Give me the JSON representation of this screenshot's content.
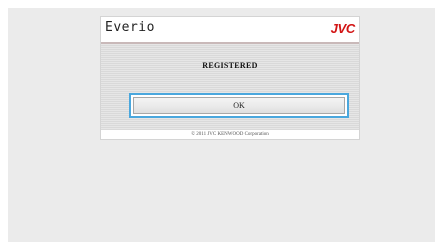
{
  "header": {
    "app_name": "Everio",
    "brand_logo": "JVC",
    "brand_color": "#d21414"
  },
  "main": {
    "status_text": "REGISTERED",
    "ok_button_label": "OK",
    "focus_outline_color": "#4aa7dd"
  },
  "footer": {
    "copyright": "© 2011 JVC KENWOOD Corporation"
  }
}
